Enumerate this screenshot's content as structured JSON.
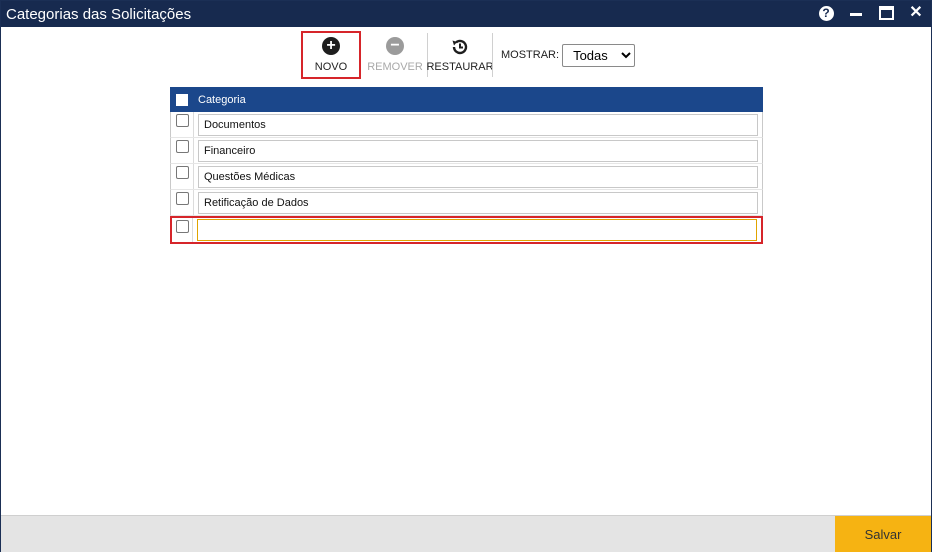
{
  "window": {
    "title": "Categorias das Solicitações"
  },
  "titlebar_icons": [
    "help-icon",
    "minimize-icon",
    "maximize-icon",
    "close-icon"
  ],
  "titlebar_help_glyph": "?",
  "toolbar": {
    "novo_label": "NOVO",
    "remover_label": "REMOVER",
    "restaurar_label": "RESTAURAR",
    "mostrar_label": "MOSTRAR:",
    "mostrar_selected": "Todas"
  },
  "grid": {
    "header": "Categoria",
    "rows": [
      {
        "value": "Documentos"
      },
      {
        "value": "Financeiro"
      },
      {
        "value": "Questões Médicas"
      },
      {
        "value": "Retificação de Dados"
      },
      {
        "value": ""
      }
    ]
  },
  "footer": {
    "save_label": "Salvar"
  },
  "colors": {
    "titlebar": "#172a4f",
    "grid_header": "#1b478b",
    "highlight": "#d6252a",
    "save_button": "#f6b312"
  }
}
